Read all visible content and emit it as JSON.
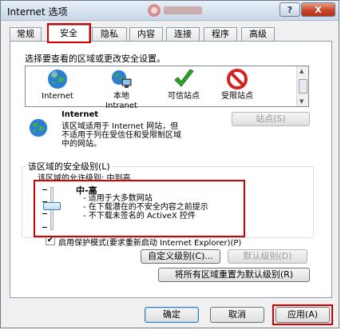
{
  "window": {
    "title": "Internet 选项",
    "help_label": "?",
    "close_label": "X"
  },
  "tabs": [
    {
      "label": "常规"
    },
    {
      "label": "安全"
    },
    {
      "label": "隐私"
    },
    {
      "label": "内容"
    },
    {
      "label": "连接"
    },
    {
      "label": "程序"
    },
    {
      "label": "高级"
    }
  ],
  "active_tab": "安全",
  "security": {
    "zone_prompt": "选择要查看的区域或更改安全设置。",
    "zones": [
      {
        "name": "Internet",
        "icon": "globe-icon"
      },
      {
        "name": "本地\nIntranet",
        "icon": "intranet-icon"
      },
      {
        "name": "可信站点",
        "icon": "checkmark-icon"
      },
      {
        "name": "受限站点",
        "icon": "no-entry-icon"
      }
    ],
    "selected_zone_title": "Internet",
    "selected_zone_desc_1": "该区域适用于 Internet 网站，但",
    "selected_zone_desc_2": "不适用于列在受信任和受限制区域",
    "selected_zone_desc_3": "中的网站。",
    "sites_button": "站点(S)",
    "level_group_title": "该区域的安全级别(L)",
    "allowed_levels": "该区域的允许级别: 中到高",
    "level_name": "中-高",
    "level_bullet_1": "- 适用于大多数网站",
    "level_bullet_2": "- 在下载潜在的不安全内容之前提示",
    "level_bullet_3": "- 不下载未签名的 ActiveX 控件",
    "protected_mode_label": "启用保护模式(要求重新启动 Internet Explorer)(P)",
    "protected_mode_checked": true,
    "custom_level_button": "自定义级别(C)...",
    "default_level_button": "默认级别(D)",
    "reset_all_button": "将所有区域重置为默认级别(R)"
  },
  "footer": {
    "ok_button": "确定",
    "cancel_button": "取消",
    "apply_button": "应用(A)"
  },
  "colors": {
    "highlight_red": "#d40000",
    "title_gradient_top": "#e8f0f8",
    "close_button": "#c8452a"
  }
}
